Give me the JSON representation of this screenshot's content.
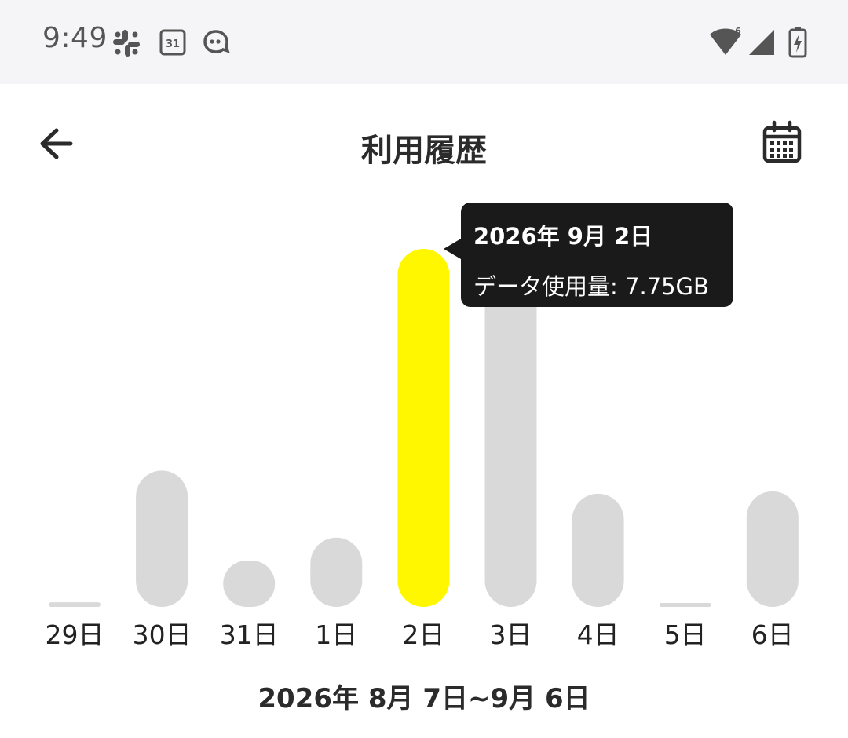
{
  "status_bar": {
    "time": "9:49",
    "left_icons": [
      "slack-icon",
      "calendar-31-icon",
      "chat-bubble-icon"
    ],
    "calendar_badge": "31",
    "wifi_badge": "6",
    "right_icons": [
      "wifi-icon",
      "cell-signal-icon",
      "battery-charging-icon"
    ]
  },
  "header": {
    "title": "利用履歴",
    "back_icon": "arrow-left-icon",
    "calendar_icon": "calendar-icon"
  },
  "colors": {
    "bar_default": "#d9d9d9",
    "bar_selected": "#fff700",
    "tooltip_bg": "#1a1a1a"
  },
  "chart_data": {
    "type": "bar",
    "categories": [
      "29日",
      "30日",
      "31日",
      "1日",
      "2日",
      "3日",
      "4日",
      "5日",
      "6日"
    ],
    "values": [
      0.1,
      2.95,
      1.0,
      1.5,
      7.75,
      7.0,
      2.45,
      0.05,
      2.5
    ],
    "ylim": [
      0,
      7.75
    ],
    "selected_index": 4,
    "grid": false,
    "legend": "none"
  },
  "tooltip": {
    "date": "2026年 9月 2日",
    "usage": "データ使用量: 7.75GB"
  },
  "period_label": "2026年 8月 7日~9月 6日"
}
